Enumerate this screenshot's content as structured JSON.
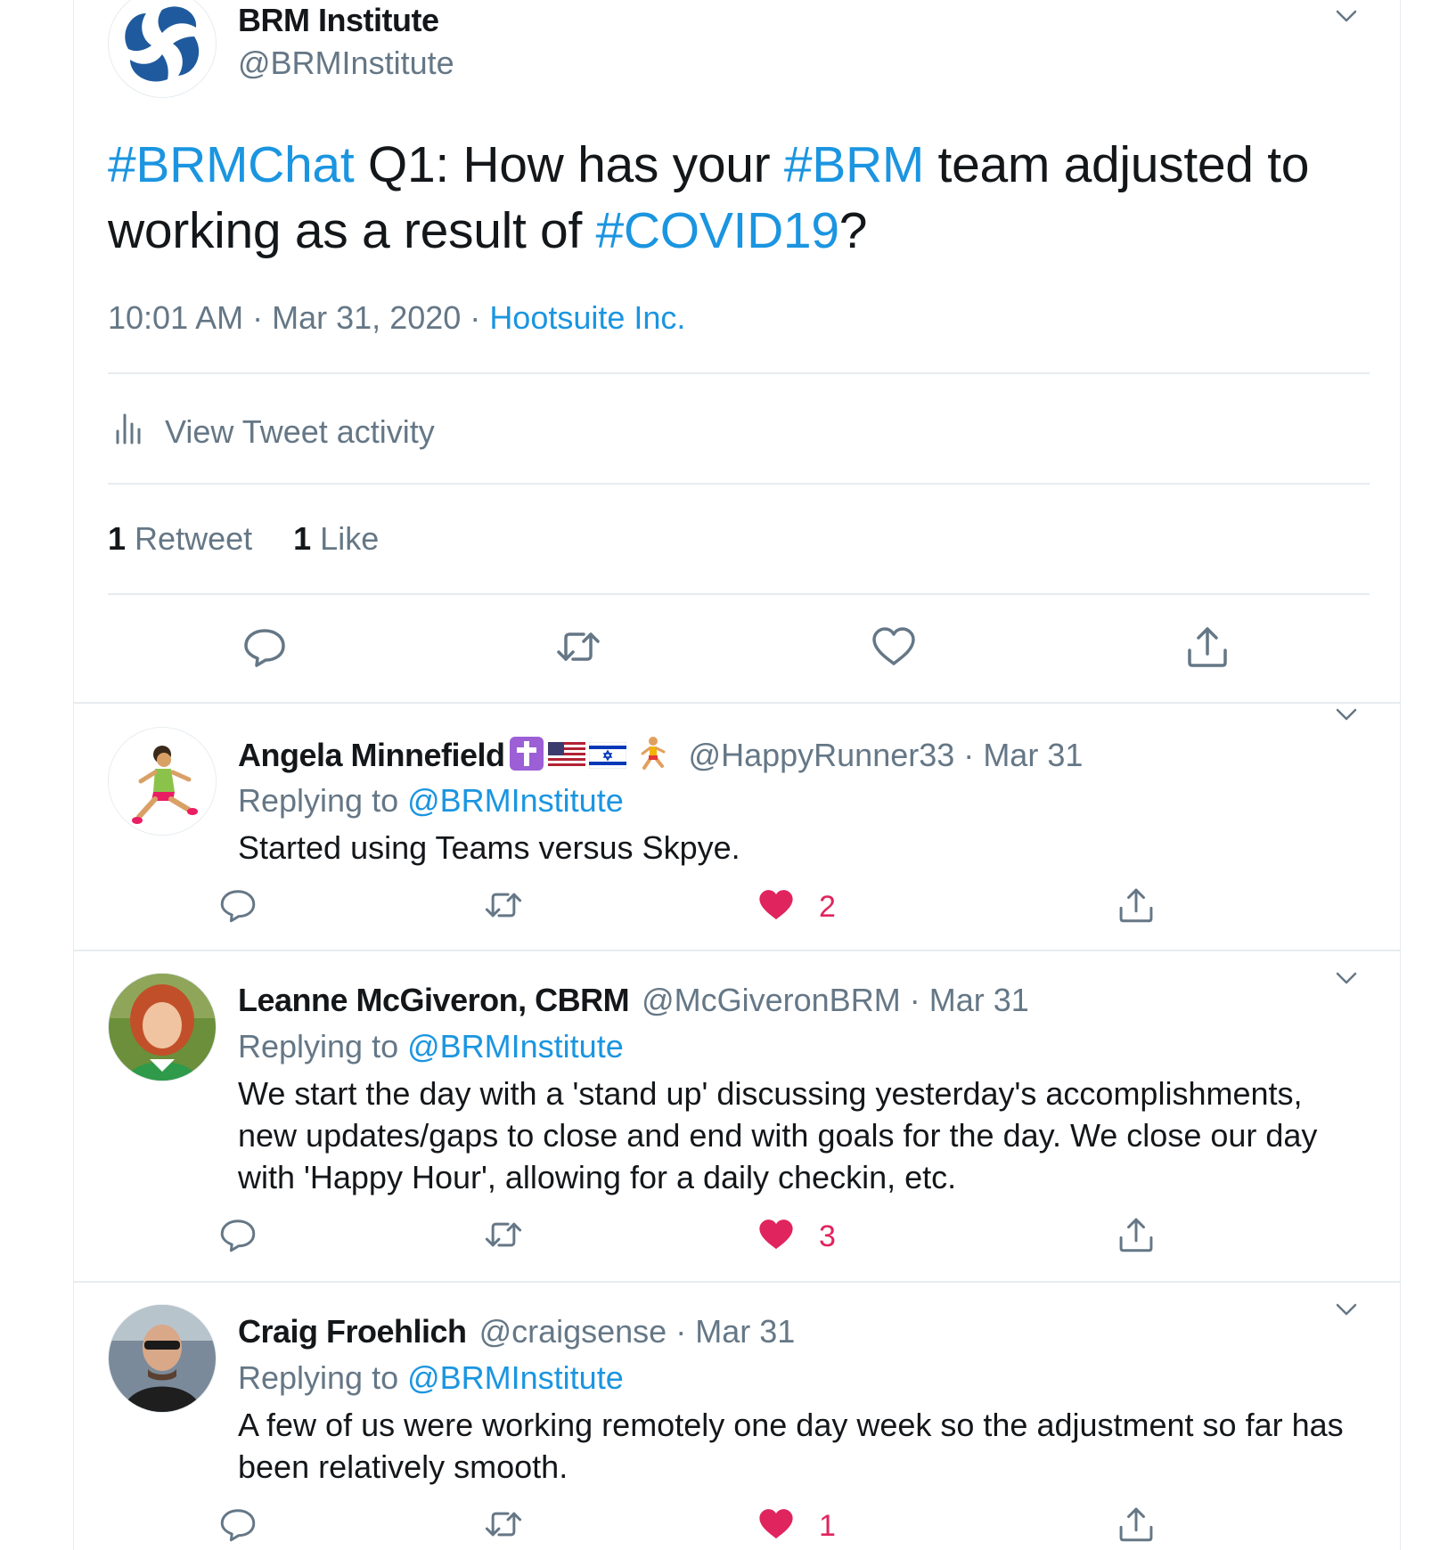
{
  "main_tweet": {
    "author_name": "BRM Institute",
    "author_handle": "@BRMInstitute",
    "text_parts": [
      "#BRMChat",
      " Q1: How has your ",
      "#BRM",
      " team adjusted to working as a result of ",
      "#COVID19",
      "?"
    ],
    "time": "10:01 AM",
    "date": "Mar 31, 2020",
    "separator": "·",
    "source": "Hootsuite Inc.",
    "activity_label": "View Tweet activity",
    "retweet_count": "1",
    "retweet_label": "Retweet",
    "like_count": "1",
    "like_label": "Like"
  },
  "replies": [
    {
      "name": "Angela Minnefield",
      "handle": "@HappyRunner33",
      "date": "Mar 31",
      "replying_prefix": "Replying to ",
      "replying_to": "@BRMInstitute",
      "text": "Started using Teams versus Skpye.",
      "likes": "2"
    },
    {
      "name": "Leanne McGiveron, CBRM",
      "handle": "@McGiveronBRM",
      "date": "Mar 31",
      "replying_prefix": "Replying to ",
      "replying_to": "@BRMInstitute",
      "text": "We start the day with a 'stand up' discussing yesterday's accomplishments, new updates/gaps to close and end with goals for the day. We close our day with 'Happy Hour', allowing for a daily checkin, etc.",
      "likes": "3"
    },
    {
      "name": "Craig Froehlich",
      "handle": "@craigsense",
      "date": "Mar 31",
      "replying_prefix": "Replying to ",
      "replying_to": "@BRMInstitute",
      "text": "A few of us were working remotely one day week so the adjustment so far has been relatively smooth.",
      "likes": "1"
    }
  ],
  "colors": {
    "link": "#1b95e0",
    "secondary": "#657786",
    "like": "#e0245e",
    "divider": "#e6ecf0"
  },
  "icons": [
    "chevron-down-icon",
    "reply-icon",
    "retweet-icon",
    "like-icon",
    "share-icon",
    "analytics-icon"
  ]
}
